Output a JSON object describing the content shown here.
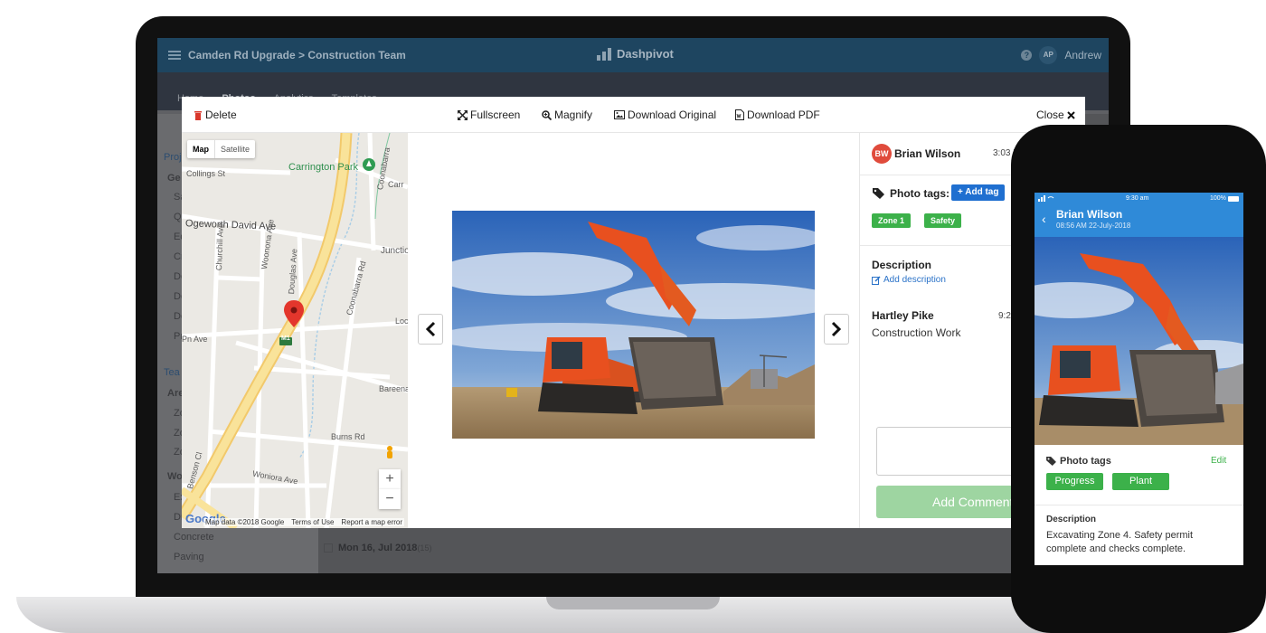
{
  "app": {
    "breadcrumb": "Camden Rd Upgrade > Construction Team",
    "brand": "Dashpivot",
    "user_initials": "AP",
    "user_name": "Andrew",
    "help": "?",
    "nav": [
      "Home",
      "Photos",
      "Analytics",
      "Templates"
    ]
  },
  "sidebar": {
    "items": [
      {
        "text": "Proj"
      },
      {
        "text": "Ge"
      },
      {
        "text": "Sa"
      },
      {
        "text": "Qi"
      },
      {
        "text": "Ed"
      },
      {
        "text": "Cr"
      },
      {
        "text": "De"
      },
      {
        "text": "De"
      },
      {
        "text": "De"
      },
      {
        "text": "Pr"
      },
      {
        "text": "Tea"
      },
      {
        "text": "Are"
      },
      {
        "text": "Zo"
      },
      {
        "text": "Zo"
      },
      {
        "text": "Zo"
      },
      {
        "text": "Wo"
      },
      {
        "text": "Ex"
      },
      {
        "text": "Dr"
      },
      {
        "text": "Concrete"
      },
      {
        "text": "Paving"
      }
    ]
  },
  "feed": {
    "date": "Mon 16, Jul 2018",
    "count": "(15)"
  },
  "modal": {
    "toolbar": {
      "delete": "Delete",
      "fullscreen": "Fullscreen",
      "magnify": "Magnify",
      "download_original": "Download Original",
      "download_pdf": "Download PDF",
      "close": "Close"
    },
    "map": {
      "type_map": "Map",
      "type_satellite": "Satellite",
      "zoom_in": "+",
      "zoom_out": "−",
      "road_badge": "M1",
      "google": "Google",
      "labels": {
        "collings": "Collings St",
        "carrington_park": "Carrington Park",
        "coonabarra": "Coonabarra",
        "carr": "Carr",
        "edgeworth": "Ogeworth David Ave",
        "junction": "Junctio",
        "churchill": "Churchill Ave",
        "woonona": "Woonona Ave",
        "douglas": "Douglas Ave",
        "coonabarra_rd": "Coonabarra Rd",
        "loc": "Locl",
        "pn_ave": "Pn Ave",
        "bareena": "Bareena",
        "burns": "Burns Rd",
        "woniora": "Woniora Ave",
        "benson": "Benson Cl"
      },
      "footer": [
        "Map data ©2018 Google",
        "Terms of Use",
        "Report a map error"
      ]
    },
    "detail": {
      "author_initials": "BW",
      "author_name": "Brian Wilson",
      "time": "3:03 P",
      "photo_tags_label": "Photo tags:",
      "add_tag": "+ Add tag",
      "tags": [
        "Zone 1",
        "Safety"
      ],
      "description_label": "Description",
      "add_description": "Add description",
      "comment_author": "Hartley Pike",
      "comment_time": "9:2",
      "comment_text": "Construction Work",
      "add_comment": "Add Comment"
    }
  },
  "phone": {
    "status_time": "9:30 am",
    "status_battery": "100%",
    "name": "Brian Wilson",
    "date": "08:56 AM 22-July-2018",
    "photo_tags_label": "Photo tags",
    "edit": "Edit",
    "tags": [
      "Progress",
      "Plant"
    ],
    "description_label": "Description",
    "description": "Excavating Zone 4. Safety permit complete and checks complete."
  },
  "colors": {
    "header_blue": "#1e4560",
    "accent_blue": "#1f6fd0",
    "tag_green": "#3cb14a",
    "avatar_red": "#e04b3c",
    "excavator_orange": "#e8501f"
  }
}
